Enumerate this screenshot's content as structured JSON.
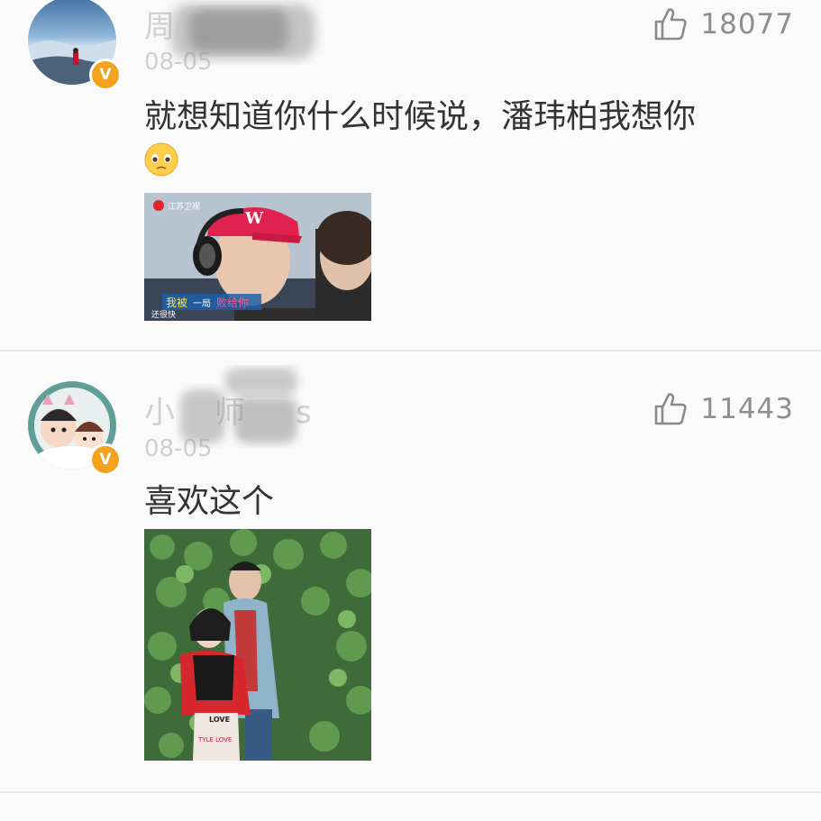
{
  "comments": [
    {
      "username": "周",
      "timestamp": "08-05",
      "likes": "18077",
      "text_line1": "就想知道你什么时候说，潘玮柏我想你",
      "emoji": "pleading-face",
      "image": {
        "station_logo": "江苏卫视",
        "caption_left": "我被",
        "caption_highlight": "一局",
        "caption_right": "败给你",
        "corner_text": "还很快"
      }
    },
    {
      "username": "小",
      "username_mid": "师",
      "username_end": "s",
      "timestamp": "08-05",
      "likes": "11443",
      "text_line1": "喜欢这个",
      "image": {
        "shirt_text_1": "LOVE",
        "shirt_text_2": "TYLE LOVE"
      }
    }
  ],
  "verified_badge": "V",
  "colors": {
    "badge": "#f2a21c",
    "text": "#333333",
    "meta": "#8e8e8e",
    "divider": "#e6e6e6"
  }
}
